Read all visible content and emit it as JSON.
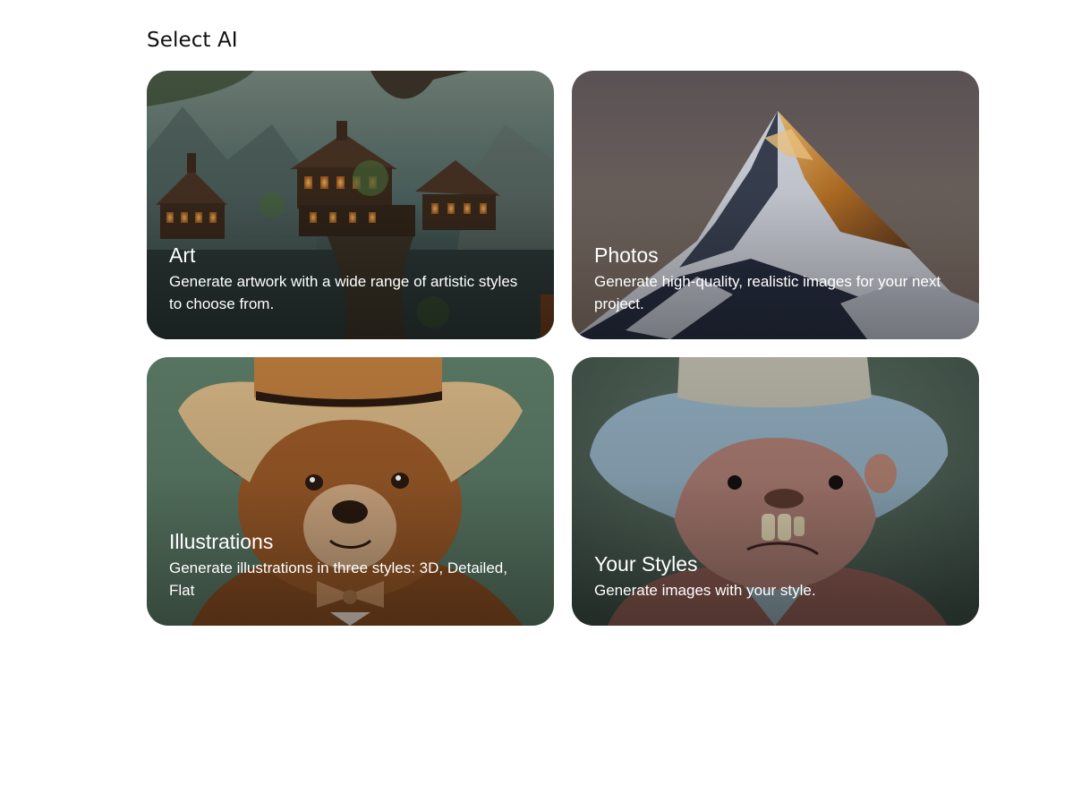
{
  "header": {
    "title": "Select AI"
  },
  "cards": [
    {
      "title": "Art",
      "description": "Generate artwork with a wide range of artistic styles to choose from.",
      "image": "fantasy-treehouse-village"
    },
    {
      "title": "Photos",
      "description": "Generate high-quality, realistic images for your next project.",
      "image": "snowy-mountain-peak"
    },
    {
      "title": "Illustrations",
      "description": "Generate illustrations in three styles: 3D, Detailed, Flat",
      "image": "cartoon-bear-cowboy-hat"
    },
    {
      "title": "Your Styles",
      "description": "Generate images with your style.",
      "image": "knitted-bear-hat"
    }
  ],
  "colors": {
    "background": "#ffffff",
    "heading": "#111111",
    "card_text": "#ffffff",
    "illustration_bg": "#5b7a66",
    "knitted_bg": "#4f6558"
  }
}
